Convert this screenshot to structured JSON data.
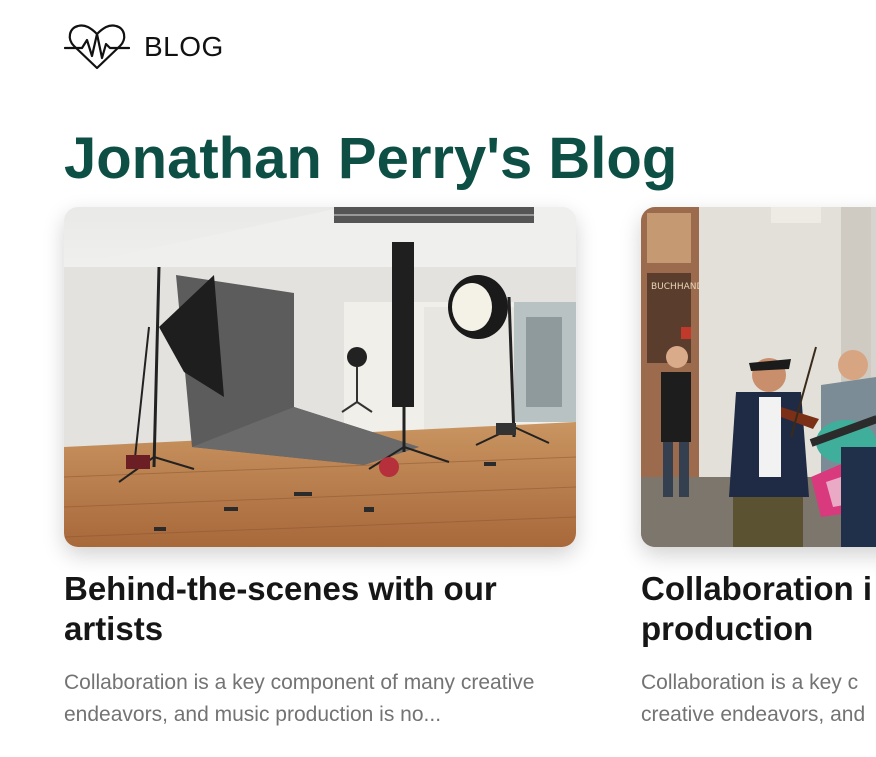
{
  "header": {
    "logo_icon": "heart-pulse-icon",
    "brand": "BLOG"
  },
  "page": {
    "title": "Jonathan Perry's Blog"
  },
  "posts": [
    {
      "title": "Behind-the-scenes with our artists",
      "excerpt": "Collaboration is a key component of many creative endeavors, and music production is no...",
      "image": "photo studio with softboxes and backdrop"
    },
    {
      "title_line1": "Collaboration i",
      "title_line2": "production",
      "excerpt_line1": "Collaboration is a key c",
      "excerpt_line2": "creative endeavors, and",
      "image": "street musicians playing violin and guitar"
    }
  ],
  "colors": {
    "title": "#0d4f44",
    "text": "#161616",
    "muted": "#737373"
  }
}
